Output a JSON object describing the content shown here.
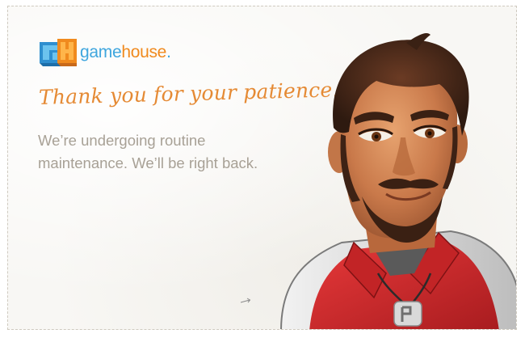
{
  "brand": {
    "name_part1": "game",
    "name_part2": "house",
    "name_suffix": ".",
    "colors": {
      "blue": "#3fa6de",
      "orange": "#f08a1e"
    }
  },
  "main": {
    "headline": "Thank you for your patience.",
    "message_line1": "We’re undergoing routine",
    "message_line2": "maintenance.  We’ll be right back."
  },
  "icons": {
    "logo": "gamehouse-logo-icon",
    "mascot": "mascot-illustration",
    "arrow": "arrow-icon"
  },
  "colors": {
    "headline": "#e58a34",
    "message": "#a8a196",
    "background": "#f8f7f4",
    "shirt_red": "#d8282a"
  }
}
